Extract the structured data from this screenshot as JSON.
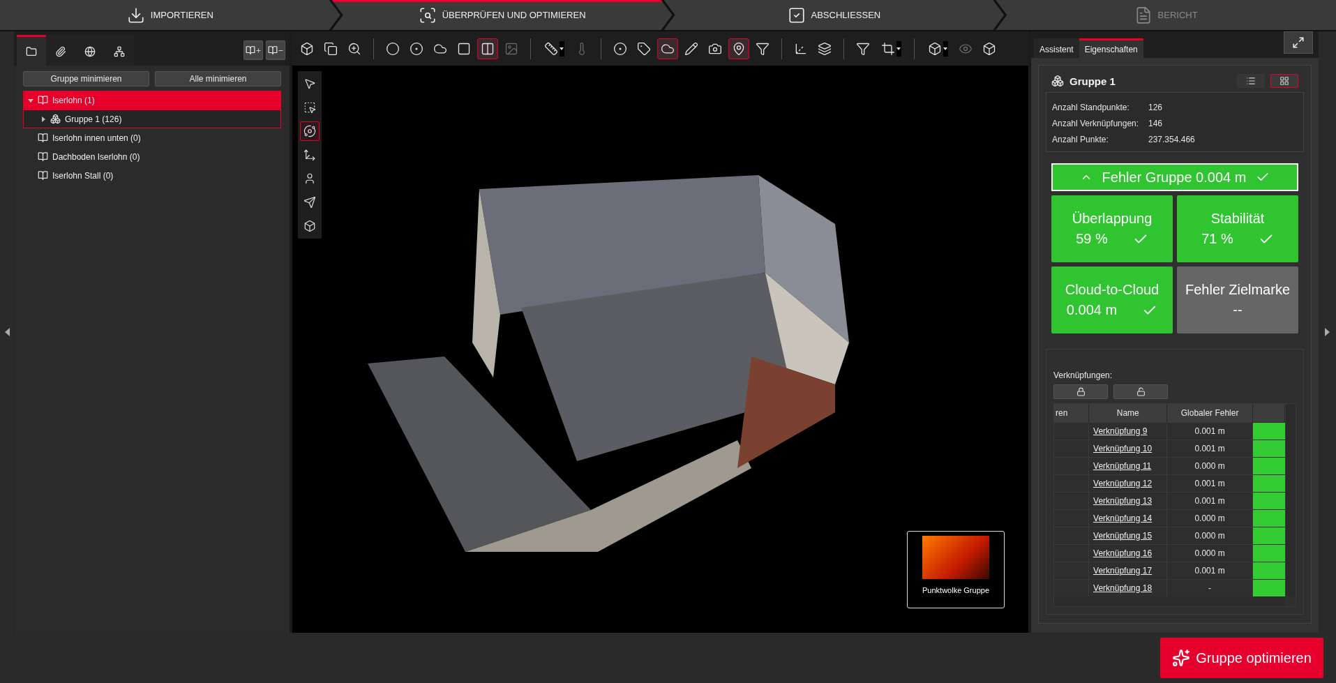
{
  "steps": [
    {
      "label": "IMPORTIEREN",
      "selected": false,
      "disabled": false
    },
    {
      "label": "ÜBERPRÜFEN UND OPTIMIEREN",
      "selected": true,
      "disabled": false
    },
    {
      "label": "ABSCHLIESSEN",
      "selected": false,
      "disabled": false
    },
    {
      "label": "BERICHT",
      "selected": false,
      "disabled": true
    }
  ],
  "left_panel": {
    "tabs": [
      {
        "selected": true
      },
      {
        "selected": false
      },
      {
        "selected": false
      },
      {
        "selected": false
      }
    ],
    "buttons": [
      "Gruppe minimieren",
      "Alle minimieren"
    ],
    "tree": [
      {
        "label": "Iserlohn (1)",
        "kind": "project",
        "selected": true,
        "focused": false,
        "expanded": true,
        "children": [
          {
            "label": "Gruppe 1 (126)",
            "kind": "group",
            "selected": false,
            "focused": true,
            "expanded": false
          }
        ]
      },
      {
        "label": "Iserlohn innen unten  (0)",
        "kind": "project",
        "selected": false,
        "focused": false
      },
      {
        "label": "Dachboden Iserlohn (0)",
        "kind": "project",
        "selected": false,
        "focused": false
      },
      {
        "label": "Iserlohn Stall (0)",
        "kind": "project",
        "selected": false,
        "focused": false
      }
    ]
  },
  "toolbar": {
    "groups": [
      [
        {
          "active": false,
          "disabled": false,
          "dropdown": false
        },
        {
          "active": false,
          "disabled": false,
          "dropdown": false
        },
        {
          "active": false,
          "disabled": false,
          "dropdown": false
        }
      ],
      [
        {
          "active": false,
          "disabled": false,
          "dropdown": false
        },
        {
          "active": false,
          "disabled": false,
          "dropdown": false
        },
        {
          "active": false,
          "disabled": false,
          "dropdown": false
        },
        {
          "active": false,
          "disabled": false,
          "dropdown": false
        },
        {
          "active": true,
          "disabled": false,
          "dropdown": false
        },
        {
          "active": false,
          "disabled": true,
          "dropdown": false
        }
      ],
      [
        {
          "active": false,
          "disabled": false,
          "dropdown": true
        },
        {
          "active": false,
          "disabled": true,
          "dropdown": false
        }
      ],
      [
        {
          "active": false,
          "disabled": false,
          "dropdown": false
        },
        {
          "active": false,
          "disabled": false,
          "dropdown": false
        },
        {
          "active": true,
          "disabled": false,
          "dropdown": false
        },
        {
          "active": false,
          "disabled": false,
          "dropdown": false
        },
        {
          "active": false,
          "disabled": false,
          "dropdown": false
        },
        {
          "active": true,
          "disabled": false,
          "dropdown": false
        },
        {
          "active": false,
          "disabled": false,
          "dropdown": false
        }
      ],
      [
        {
          "active": false,
          "disabled": false,
          "dropdown": false
        },
        {
          "active": false,
          "disabled": false,
          "dropdown": false
        }
      ],
      [
        {
          "active": false,
          "disabled": false,
          "dropdown": false
        },
        {
          "active": false,
          "disabled": false,
          "dropdown": true
        }
      ],
      [
        {
          "active": false,
          "disabled": false,
          "dropdown": true
        },
        {
          "active": false,
          "disabled": true,
          "dropdown": false
        },
        {
          "active": false,
          "disabled": false,
          "dropdown": false
        }
      ]
    ]
  },
  "view_tools": [
    {
      "selected": false
    },
    {
      "selected": false
    },
    {
      "selected": true
    },
    {
      "selected": false
    },
    {
      "selected": false
    },
    {
      "selected": false
    },
    {
      "selected": false
    }
  ],
  "thumbnail": {
    "caption": "Punktwolke Gruppe"
  },
  "right_panel": {
    "tabs": [
      {
        "label": "Assistent",
        "selected": false
      },
      {
        "label": "Eigenschaften",
        "selected": true
      }
    ],
    "group": {
      "title": "Gruppe 1",
      "views": [
        {
          "selected": false
        },
        {
          "selected": true
        }
      ],
      "stats": [
        {
          "label": "Anzahl Standpunkte:",
          "value": "126"
        },
        {
          "label": "Anzahl Verknüpfungen:",
          "value": "146"
        },
        {
          "label": "Anzahl Punkte:",
          "value": "237.354.466"
        }
      ],
      "summary": {
        "label": "Fehler Gruppe 0.004 m",
        "expanded": true,
        "ok": true
      },
      "tiles": [
        {
          "title": "Überlappung",
          "value": "59 %",
          "ok": true
        },
        {
          "title": "Stabilität",
          "value": "71 %",
          "ok": true
        },
        {
          "title": "Cloud-to-Cloud",
          "value": "0.004 m",
          "ok": true
        },
        {
          "title": "Fehler Zielmarke",
          "value": "--",
          "ok": false
        }
      ]
    },
    "links": {
      "label": "Verknüpfungen:",
      "columns": [
        "ren",
        "Name",
        "Globaler Fehler"
      ],
      "rows": [
        {
          "name": "Verknüpfung 9",
          "error": "0.001 m",
          "color": "#33cc33"
        },
        {
          "name": "Verknüpfung 10",
          "error": "0.001 m",
          "color": "#33cc33"
        },
        {
          "name": "Verknüpfung 11",
          "error": "0.000 m",
          "color": "#33cc33"
        },
        {
          "name": "Verknüpfung 12",
          "error": "0.001 m",
          "color": "#33cc33"
        },
        {
          "name": "Verknüpfung 13",
          "error": "0.001 m",
          "color": "#33cc33"
        },
        {
          "name": "Verknüpfung 14",
          "error": "0.000 m",
          "color": "#33cc33"
        },
        {
          "name": "Verknüpfung 15",
          "error": "0.000 m",
          "color": "#33cc33"
        },
        {
          "name": "Verknüpfung 16",
          "error": "0.000 m",
          "color": "#33cc33"
        },
        {
          "name": "Verknüpfung 17",
          "error": "0.001 m",
          "color": "#33cc33"
        },
        {
          "name": "Verknüpfung 18",
          "error": "-",
          "color": "#33cc33"
        }
      ]
    }
  },
  "action_button": "Gruppe optimieren"
}
